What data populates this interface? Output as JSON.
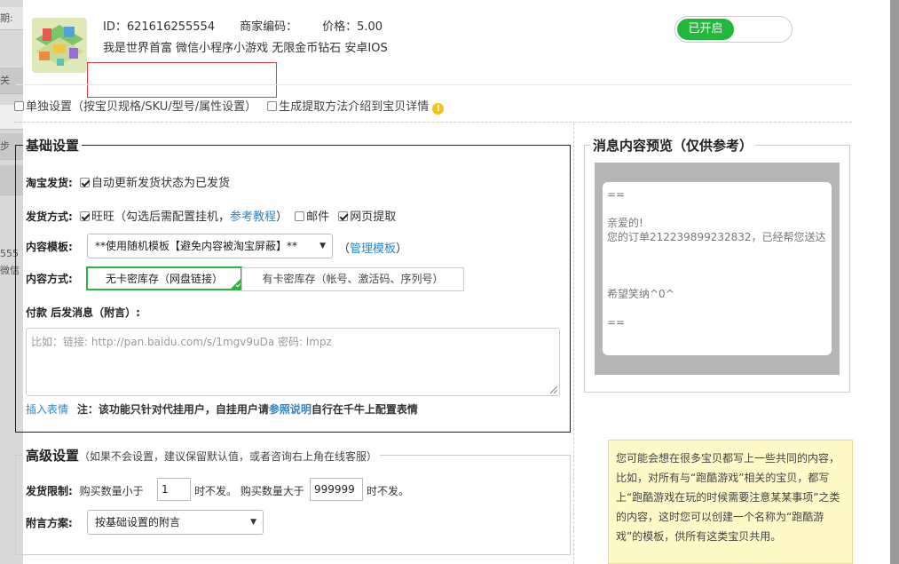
{
  "background": {
    "cells": [
      "期:",
      "关",
      "",
      "步",
      "",
      "555",
      "微信"
    ]
  },
  "product": {
    "id_text": "ID：621616255554",
    "merchant_code_text": "商家编码：",
    "price_text": "价格：5.00",
    "title": "我是世界首富 微信小程序小游戏 无限金币钻石 安卓IOS",
    "toggle_label": "已开启"
  },
  "options": {
    "individual_label": "单独设置（按宝贝规格/SKU/型号/属性设置）",
    "generate_label": "生成提取方法介绍到宝贝详情",
    "warn_glyph": "!"
  },
  "basic": {
    "legend": "基础设置",
    "taobao_label": "淘宝发货:",
    "taobao_option": "自动更新发货状态为已发货",
    "delivery_label": "发货方式:",
    "wangwang": "旺旺（勾选后需配置挂机，",
    "ref_link": "参考教程",
    "paren_close": "）",
    "mail": "邮件",
    "web": "网页提取",
    "template_label": "内容模板:",
    "template_value": "**使用随机模板【避免内容被淘宝屏蔽】**",
    "manage_open": "（",
    "manage_link": "管理模板",
    "manage_close": "）",
    "content_label": "内容方式:",
    "tab_no_card": "无卡密库存（网盘链接）",
    "tab_card": "有卡密库存（帐号、激活码、序列号）",
    "after_pay_label": "付款 后发消息（附言）:",
    "textarea_placeholder": "比如：链接: http://pan.baidu.com/s/1mgv9uDa 密码: lmpz",
    "emoji_link": "插入表情",
    "note_pre": "注：该功能只针对代挂用户，自挂用户请",
    "note_link": "参照说明",
    "note_post": "自行在千牛上配置表情"
  },
  "advanced": {
    "legend": "高级设置",
    "legend_hint": "（如果不会设置，建议保留默认值，或者咨询右上角在线客服）",
    "limit_label": "发货限制:",
    "limit_pre": "购买数量小于",
    "limit_min": "1",
    "limit_mid": "时不发。 购买数量大于",
    "limit_max": "999999",
    "limit_post": "时不发。",
    "scheme_label": "附言方案:",
    "scheme_value": "按基础设置的附言"
  },
  "preview": {
    "legend": "消息内容预览（仅供参考）",
    "lines": [
      "==",
      "",
      "亲爱的!",
      "您的订单212239899232832，已经帮您送达",
      "",
      "",
      "",
      "",
      "希望笑纳^0^",
      "",
      "=="
    ]
  },
  "tip": {
    "text": "您可能会想在很多宝贝都写上一些共同的内容，比如，对所有与“跑酷游戏”相关的宝贝，都写上“跑酷游戏在玩的时候需要注意某某事项”之类的内容，这时您可以创建一个名称为“跑酷游戏”的模板，供所有这类宝贝共用。"
  },
  "colors": {
    "accent_green": "#22b83b",
    "link_blue": "#2a86c8",
    "warn_yellow": "#f1c40f",
    "error_red": "#e23d3d",
    "note_bg": "#fff9c7"
  }
}
